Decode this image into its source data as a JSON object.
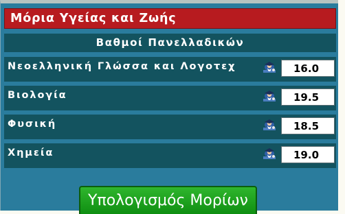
{
  "widget": {
    "title": "Μόρια Υγείας και Ζωής",
    "subheader": "Βαθμοί Πανελλαδικών"
  },
  "subjects": [
    {
      "label": "Νεοελληνική Γλώσσα και Λογοτεχ",
      "value": "16.0",
      "icon": "scholar-icon"
    },
    {
      "label": "Βιολογία",
      "value": "19.5",
      "icon": "scholar-icon"
    },
    {
      "label": "Φυσική",
      "value": "18.5",
      "icon": "scholar-icon"
    },
    {
      "label": "Χημεία",
      "value": "19.0",
      "icon": "scholar-icon"
    }
  ],
  "calculate_button": {
    "label": "Υπολογισμός Μορίων"
  },
  "colors": {
    "title_bar": "#b71b1f",
    "panel": "#2a7c9d",
    "row": "#13535f",
    "button": "#1fa31f"
  }
}
